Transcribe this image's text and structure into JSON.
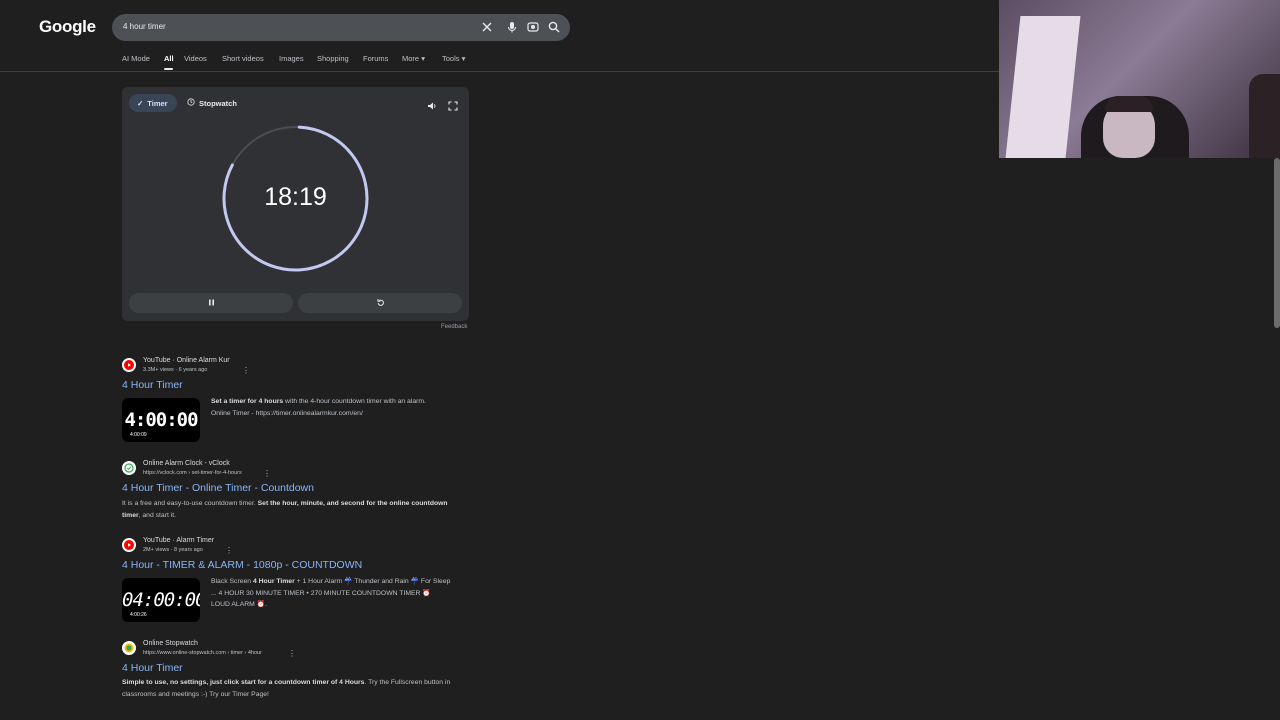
{
  "logo": "Google",
  "search": {
    "query": "4 hour timer"
  },
  "tabs": [
    "AI Mode",
    "All",
    "Videos",
    "Short videos",
    "Images",
    "Shopping",
    "Forums",
    "More",
    "Tools"
  ],
  "timer_widget": {
    "tab_timer": "Timer",
    "tab_stopwatch": "Stopwatch",
    "time": "18:19",
    "feedback": "Feedback"
  },
  "results": [
    {
      "source": "YouTube · Online Alarm Kur",
      "meta": "3.3M+ views · 6 years ago",
      "title": "4 Hour Timer",
      "thumb_text": "4:00:00",
      "thumb_duration": "4:00:09",
      "snippet_bold": "Set a timer for 4 hours",
      "snippet_rest": " with the 4-hour countdown timer with an alarm.",
      "snippet_line2": "Online Timer - https://timer.onlinealarmkur.com/en/"
    },
    {
      "source": "Online Alarm Clock - vClock",
      "meta": "https://vclock.com › set-timer-for-4-hours",
      "title": "4 Hour Timer - Online Timer - Countdown",
      "snippet_a": "It is a free and easy-to-use countdown timer. ",
      "snippet_b": "Set the hour, minute, and second for the online countdown timer",
      "snippet_c": ", and start it."
    },
    {
      "source": "YouTube · Alarm Timer",
      "meta": "2M+ views · 8 years ago",
      "title": "4 Hour - TIMER & ALARM - 1080p - COUNTDOWN",
      "thumb_text": "04:00:00",
      "thumb_duration": "4:00:26",
      "snippet_a": "Black Screen ",
      "snippet_b": "4 Hour Timer",
      "snippet_c": " + 1 Hour Alarm ☔ Thunder and Rain ☔ For Sleep",
      "snippet_line2": "... 4 HOUR 30 MINUTE TIMER • 270 MINUTE COUNTDOWN TIMER ⏰",
      "snippet_line3": "LOUD ALARM ⏰."
    },
    {
      "source": "Online Stopwatch",
      "meta": "https://www.online-stopwatch.com › timer › 4hour",
      "title": "4 Hour Timer",
      "snippet_b": "Simple to use, no settings, just click start for a countdown timer of 4 Hours",
      "snippet_c": ". Try the Fullscreen button in classrooms and meetings :-) Try our Timer Page!"
    }
  ],
  "colors": {
    "background": "#1f1f1f",
    "link": "#8ab4f8",
    "ring": "#c2c8f0"
  }
}
